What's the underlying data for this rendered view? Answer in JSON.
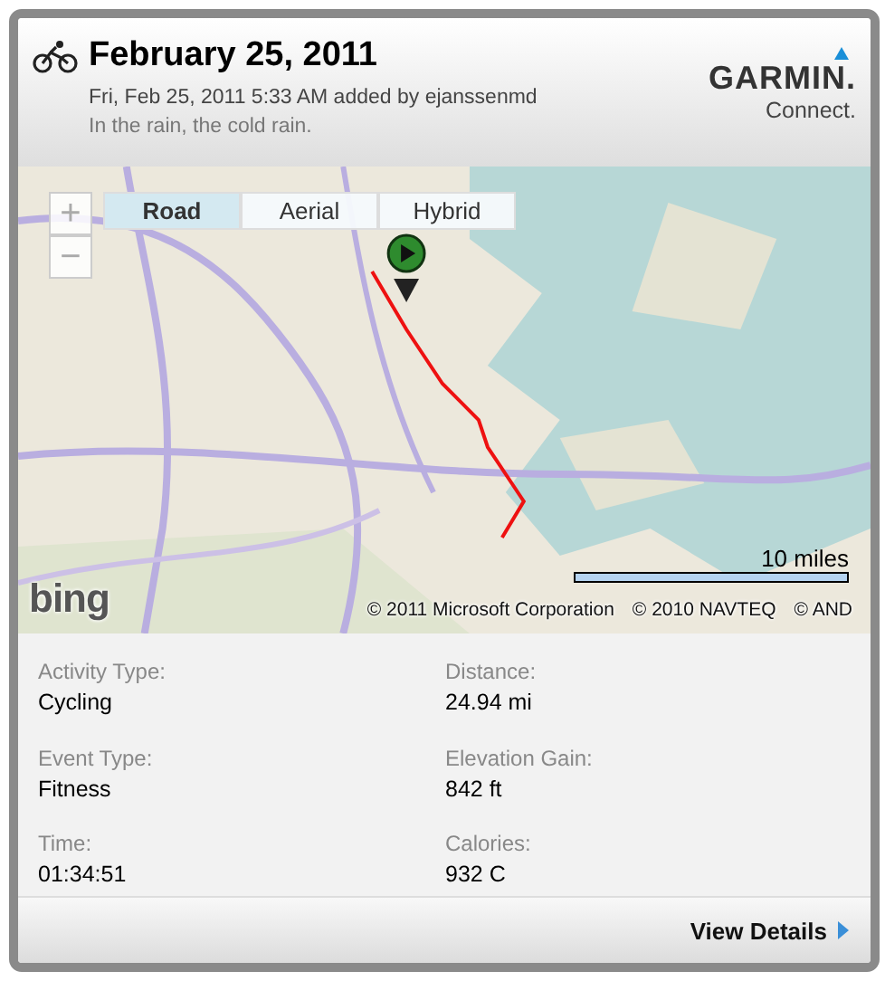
{
  "header": {
    "title": "February 25, 2011",
    "subtitle": "Fri, Feb 25, 2011 5:33 AM added by ejanssenmd",
    "description": "In the rain, the cold rain.",
    "brand": "GARMIN.",
    "brand_sub": "Connect."
  },
  "map": {
    "kind": "picture",
    "zoom_buttons": [
      "+",
      "−"
    ],
    "map_types": [
      {
        "label": "Road",
        "selected": true
      },
      {
        "label": "Aerial",
        "selected": false
      },
      {
        "label": "Hybrid",
        "selected": false
      }
    ],
    "scale": {
      "label": "10 miles"
    },
    "provider_logo": "bing",
    "copyrights": [
      "© 2011 Microsoft Corporation",
      "© 2010 NAVTEQ",
      "© AND"
    ]
  },
  "stats": [
    {
      "label": "Activity Type:",
      "value": "Cycling"
    },
    {
      "label": "Distance:",
      "value": "24.94 mi"
    },
    {
      "label": "Event Type:",
      "value": "Fitness"
    },
    {
      "label": "Elevation Gain:",
      "value": "842 ft"
    },
    {
      "label": "Time:",
      "value": "01:34:51"
    },
    {
      "label": "Calories:",
      "value": "932 C"
    }
  ],
  "footer": {
    "link": "View Details"
  }
}
